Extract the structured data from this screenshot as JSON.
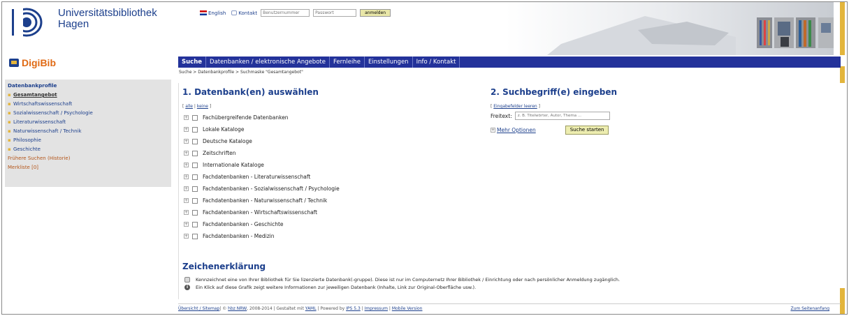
{
  "header": {
    "uni_line1": "Universitätsbibliothek",
    "uni_line2": "Hagen",
    "lang_link": "English",
    "contact_link": "Kontakt",
    "user_placeholder": "Benutzernummer",
    "password_placeholder": "Passwort",
    "login_button": "anmelden"
  },
  "brand": {
    "name": "DigiBib"
  },
  "nav": {
    "items": [
      {
        "label": "Suche",
        "active": true
      },
      {
        "label": "Datenbanken / elektronische Angebote"
      },
      {
        "label": "Fernleihe"
      },
      {
        "label": "Einstellungen"
      },
      {
        "label": "Info / Kontakt"
      }
    ]
  },
  "breadcrumb": "Suche > Datenbankprofile > Suchmaske \"Gesamtangebot\"",
  "sidebar": {
    "heading": "Datenbankprofile",
    "items": [
      "Gesamtangebot",
      "Wirtschaftswissenschaft",
      "Sozialwissenschaft / Psychologie",
      "Literaturwissenschaft",
      "Naturwissenschaft / Technik",
      "Philosophie",
      "Geschichte"
    ],
    "history_link": "Frühere Suchen (Historie)",
    "watchlist_link": "Merkliste [0]"
  },
  "section1": {
    "title": "1. Datenbank(en) auswählen",
    "bracket_open": "[",
    "all_link": "alle",
    "separator": "|",
    "none_link": "keine",
    "bracket_close": "]",
    "databases": [
      "Fachübergreifende Datenbanken",
      "Lokale Kataloge",
      "Deutsche Kataloge",
      "Zeitschriften",
      "Internationale Kataloge",
      "Fachdatenbanken - Literaturwissenschaft",
      "Fachdatenbanken - Sozialwissenschaft / Psychologie",
      "Fachdatenbanken - Naturwissenschaft / Technik",
      "Fachdatenbanken - Wirtschaftswissenschaft",
      "Fachdatenbanken - Geschichte",
      "Fachdatenbanken - Medizin"
    ]
  },
  "section2": {
    "title": "2. Suchbegriff(e) eingeben",
    "clear_link": "Eingabefelder leeren",
    "freitext_label": "Freitext:",
    "freitext_placeholder": "z. B. Titelwörter, Autor, Thema ...",
    "more_options": "Mehr Optionen",
    "search_button": "Suche starten"
  },
  "legend": {
    "title": "Zeichenerklärung",
    "rows": [
      "Kennzeichnet eine von Ihrer Bibliothek für Sie lizenzierte Datenbank(-gruppe). Diese ist nur im Computernetz Ihrer Bibliothek / Einrichtung oder nach persönlicher Anmeldung zugänglich.",
      "Ein Klick auf diese Grafik zeigt weitere Informationen zur jeweiligen Datenbank (Inhalte, Link zur Original-Oberfläche usw.)."
    ]
  },
  "footer": {
    "sitemap": "Übersicht / Sitemap",
    "copy_text": "| © ",
    "hbz": "hbz NRW",
    "years": ", 2008-2014 | Gestaltet mit ",
    "yaml": "YAML",
    "powered": " | Powered by ",
    "ips": "IPS 5.3",
    "sep": " | ",
    "impressum": "Impressum",
    "sep2": " | ",
    "mobile": "Mobile Version",
    "top": "Zum Seitenanfang"
  },
  "colors": {
    "accent": "#23329a",
    "gold": "#e3b53c",
    "brand_orange": "#e06a14"
  }
}
